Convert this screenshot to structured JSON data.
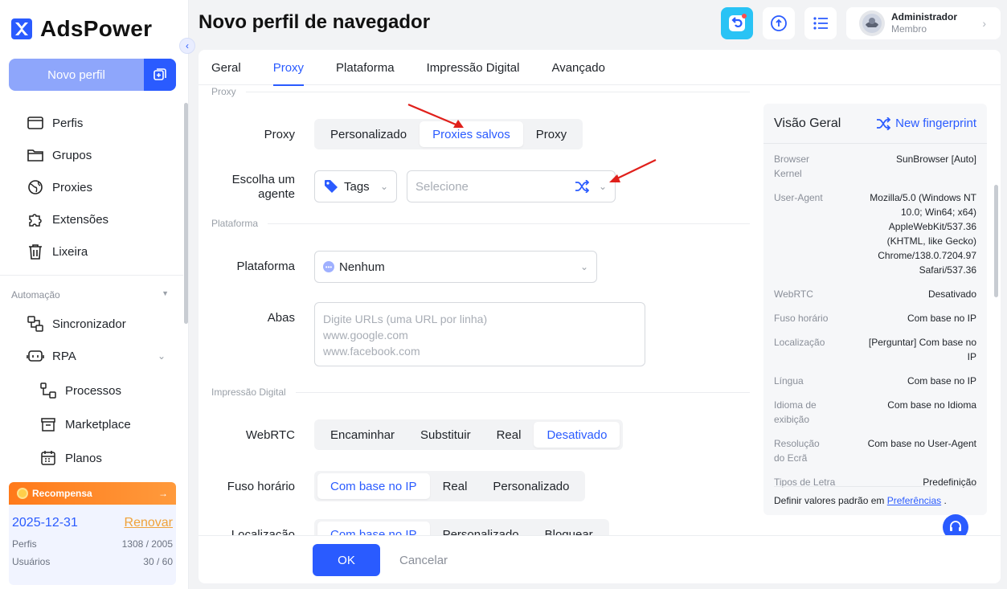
{
  "app": {
    "logo": "AdsPower"
  },
  "sidebar": {
    "new_profile": "Novo perfil",
    "items": [
      {
        "label": "Perfis",
        "icon": "profiles-icon"
      },
      {
        "label": "Grupos",
        "icon": "folder-icon"
      },
      {
        "label": "Proxies",
        "icon": "globe-icon"
      },
      {
        "label": "Extensões",
        "icon": "puzzle-icon"
      },
      {
        "label": "Lixeira",
        "icon": "trash-icon"
      }
    ],
    "automation_title": "Automação",
    "automation_items": [
      {
        "label": "Sincronizador",
        "icon": "sync-icon"
      },
      {
        "label": "RPA",
        "icon": "robot-icon"
      }
    ],
    "rpa_items": [
      {
        "label": "Processos",
        "icon": "flow-icon"
      },
      {
        "label": "Marketplace",
        "icon": "store-icon"
      },
      {
        "label": "Planos",
        "icon": "calendar-icon"
      }
    ],
    "reward": {
      "title": "Recompensa",
      "date": "2025-12-31",
      "renew": "Renovar",
      "profiles_label": "Perfis",
      "profiles_value": "1308 / 2005",
      "users_label": "Usuários",
      "users_value": "30 / 60"
    }
  },
  "header": {
    "title": "Novo perfil de navegador",
    "user_name": "Administrador",
    "user_role": "Membro"
  },
  "tabs": [
    {
      "label": "Geral",
      "active": false
    },
    {
      "label": "Proxy",
      "active": true
    },
    {
      "label": "Plataforma",
      "active": false
    },
    {
      "label": "Impressão Digital",
      "active": false
    },
    {
      "label": "Avançado",
      "active": false
    }
  ],
  "form": {
    "sec_proxy": "Proxy",
    "proxy_label": "Proxy",
    "proxy_options": [
      "Personalizado",
      "Proxies salvos",
      "Proxy"
    ],
    "proxy_selected": 1,
    "agent_label_1": "Escolha um",
    "agent_label_2": "agente",
    "tags_value": "Tags",
    "agent_placeholder": "Selecione",
    "sec_platform": "Plataforma",
    "platform_label": "Plataforma",
    "platform_value": "Nenhum",
    "tabs_label": "Abas",
    "tabs_placeholder_1": "Digite URLs (uma URL por linha)",
    "tabs_placeholder_2": "www.google.com",
    "tabs_placeholder_3": "www.facebook.com",
    "sec_fingerprint": "Impressão Digital",
    "webrtc_label": "WebRTC",
    "webrtc_options": [
      "Encaminhar",
      "Substituir",
      "Real",
      "Desativado"
    ],
    "webrtc_selected": 3,
    "timezone_label": "Fuso horário",
    "timezone_options": [
      "Com base no IP",
      "Real",
      "Personalizado"
    ],
    "timezone_selected": 0,
    "location_label": "Localização",
    "location_options": [
      "Com base no IP",
      "Personalizado",
      "Bloquear"
    ],
    "location_selected": 0
  },
  "footer": {
    "ok": "OK",
    "cancel": "Cancelar"
  },
  "overview": {
    "title": "Visão Geral",
    "new_fingerprint": "New fingerprint",
    "rows": [
      {
        "k": "Browser Kernel",
        "v": "SunBrowser [Auto]"
      },
      {
        "k": "User-Agent",
        "v": "Mozilla/5.0 (Windows NT 10.0; Win64; x64) AppleWebKit/537.36 (KHTML, like Gecko) Chrome/138.0.7204.97 Safari/537.36"
      },
      {
        "k": "WebRTC",
        "v": "Desativado"
      },
      {
        "k": "Fuso horário",
        "v": "Com base no IP"
      },
      {
        "k": "Localização",
        "v": "[Perguntar] Com base no IP"
      },
      {
        "k": "Língua",
        "v": "Com base no IP"
      },
      {
        "k": "Idioma de exibição",
        "v": "Com base no Idioma"
      },
      {
        "k": "Resolução do Ecrã",
        "v": "Com base no User-Agent"
      },
      {
        "k": "Tipos de Letra",
        "v": "Predefinição"
      }
    ],
    "footer_text": "Definir valores padrão em",
    "footer_link": "Preferências",
    "footer_end": "."
  },
  "colors": {
    "accent": "#2a5bff",
    "reward": "#ff7a1a",
    "arrow": "#e0201b"
  }
}
